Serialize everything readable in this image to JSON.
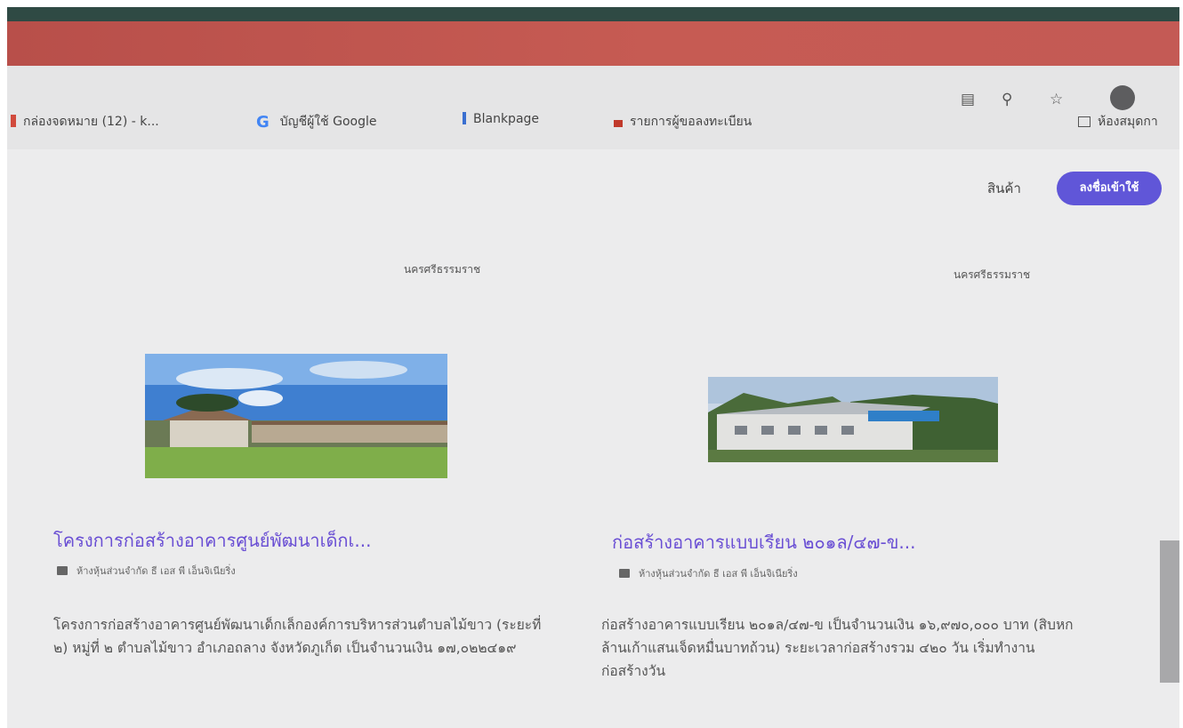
{
  "browser": {
    "bookmarks": [
      {
        "label": "กล่องจดหมาย (12) - k...",
        "icon": "mail-icon"
      },
      {
        "label": "บัญชีผู้ใช้ Google",
        "icon": "google-icon"
      },
      {
        "label": "Blankpage",
        "icon": "page-icon"
      },
      {
        "label": "รายการผู้ขอลงทะเบียน",
        "icon": "list-icon"
      }
    ],
    "reading_list_label": "ห้องสมุดกา"
  },
  "header": {
    "nav_link": "สินค้า",
    "login_button": "ลงชื่อเข้าใช้",
    "accent_color": "#6056d8"
  },
  "cards": [
    {
      "province": "นครศรีธรรมราช",
      "title": "โครงการก่อสร้างอาคารศูนย์พัฒนาเด็กเ...",
      "company": "ห้างหุ้นส่วนจำกัด ธี เอส พี เอ็นจิเนียริ่ง",
      "description": "โครงการก่อสร้างอาคารศูนย์พัฒนาเด็กเล็กองค์การบริหารส่วนตำบลไม้ขาว (ระยะที่ ๒) หมู่ที่ ๒ ตำบลไม้ขาว อำเภอถลาง จังหวัดภูเก็ต เป็นจำนวนเงิน ๑๗,๐๒๒๔๑๙"
    },
    {
      "province": "นครศรีธรรมราช",
      "title": "ก่อสร้างอาคารแบบเรียน ๒๐๑ล/๔๗-ข...",
      "company": "ห้างหุ้นส่วนจำกัด ธี เอส พี เอ็นจิเนียริ่ง",
      "description": "ก่อสร้างอาคารแบบเรียน ๒๐๑ล/๔๗-ข เป็นจำนวนเงิน ๑๖,๙๗๐,๐๐๐ บาท (สิบหกล้านเก้าแสนเจ็ดหมื่นบาทถ้วน) ระยะเวลาก่อสร้างรวม ๔๒๐ วัน เริ่มทำงานก่อสร้างวัน"
    }
  ]
}
